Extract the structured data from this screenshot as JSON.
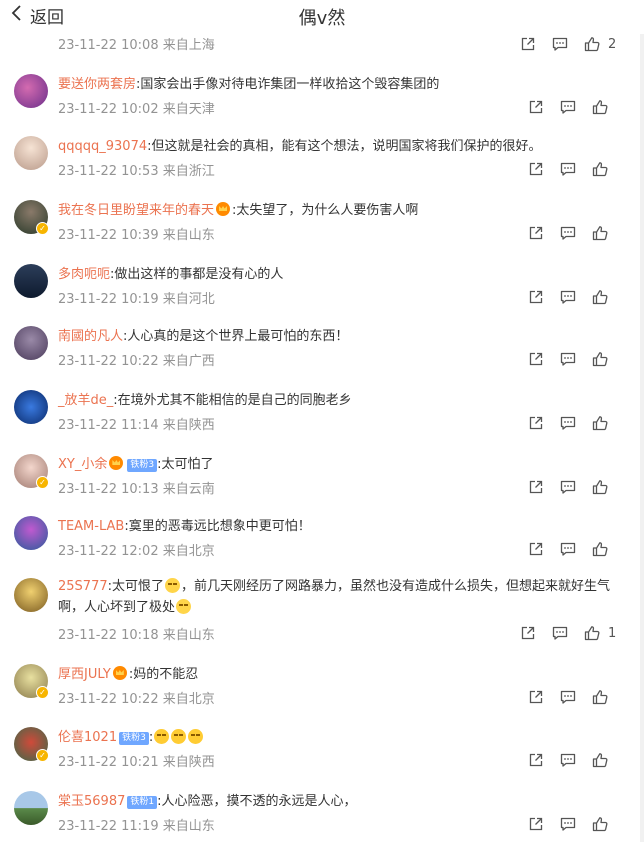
{
  "header": {
    "back_label": "返回",
    "title": "偶v然"
  },
  "comments": [
    {
      "text": "",
      "meta": "23-11-22 10:08 来自上海",
      "likes": "2"
    },
    {
      "user": "要送你两套房",
      "text": ":国家会出手像对待电诈集团一样收拾这个毁容集团的",
      "meta": "23-11-22 10:02 来自天津",
      "likes": ""
    },
    {
      "user": "qqqqq_93074",
      "text": ":但这就是社会的真相，能有这个想法，说明国家将我们保护的很好。",
      "meta": "23-11-22 10:53 来自浙江",
      "likes": ""
    },
    {
      "user": "我在冬日里盼望来年的春天",
      "text": ":太失望了，为什么人要伤害人啊",
      "meta": "23-11-22 10:39 来自山东",
      "likes": ""
    },
    {
      "user": "多肉呃呃",
      "text": ":做出这样的事都是没有心的人",
      "meta": "23-11-22 10:19 来自河北",
      "likes": ""
    },
    {
      "user": "南國的凡人",
      "text": ":人心真的是这个世界上最可怕的东西！",
      "meta": "23-11-22 10:22 来自广西",
      "likes": ""
    },
    {
      "user": "_放羊de_",
      "text": ":在境外尤其不能相信的是自己的同胞老乡",
      "meta": "23-11-22 11:14 来自陕西",
      "likes": ""
    },
    {
      "user": "XY_小余",
      "badge": "铁粉3",
      "text": ":太可怕了",
      "meta": "23-11-22 10:13 来自云南",
      "likes": ""
    },
    {
      "user": "TEAM-LAB",
      "text": ":寞里的恶毒远比想象中更可怕！",
      "meta": "23-11-22 12:02 来自北京",
      "likes": ""
    },
    {
      "user": "25S777",
      "text_a": ":太可恨了",
      "text_b": "，前几天刚经历了网路暴力，虽然也没有造成什么损失，但想起来就好生气啊，人心坏到了极处",
      "meta": "23-11-22 10:18 来自山东",
      "likes": "1"
    },
    {
      "user": "厚西JULY",
      "text": ":妈的不能忍",
      "meta": "23-11-22 10:22 来自北京",
      "likes": ""
    },
    {
      "user": "伦喜1021",
      "badge": "铁粉3",
      "text": ":",
      "meta": "23-11-22 10:21 来自陕西",
      "likes": ""
    },
    {
      "user": "棠玉56987",
      "badge": "铁粉1",
      "text": ":人心险恶，摸不透的永远是人心，",
      "meta": "23-11-22 11:19 来自山东",
      "likes": ""
    }
  ],
  "icons": {
    "back": "chevron-left-icon",
    "repost": "share-icon",
    "comment": "comment-icon",
    "like": "thumbs-up-icon",
    "verified": "verified-badge-icon",
    "crown": "crown-badge-icon",
    "emoji": "emoji-icon"
  },
  "colors": {
    "username": "#eb7350",
    "meta": "#939393",
    "text": "#333333",
    "fan_badge": "#6fa7ff"
  }
}
